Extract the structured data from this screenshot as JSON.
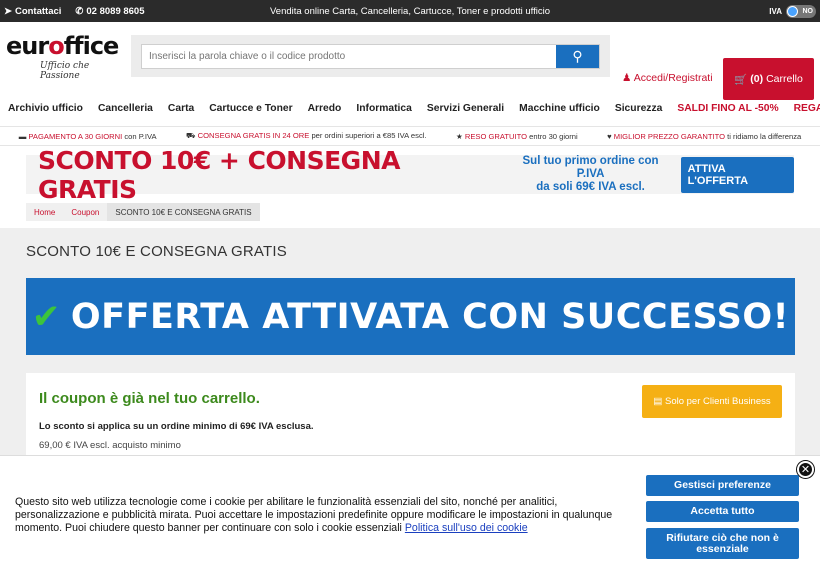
{
  "topbar": {
    "contacts": "Contattaci",
    "phone": "02 8089 8605",
    "center": "Vendita online Carta, Cancelleria, Cartucce, Toner e prodotti ufficio",
    "iva_label": "IVA",
    "iva_toggle": "NO"
  },
  "logo": {
    "word_left": "eur",
    "word_o": "o",
    "word_right": "ffice",
    "tagline": "Ufficio che Passione"
  },
  "search": {
    "placeholder": "Inserisci la parola chiave o il codice prodotto"
  },
  "account": {
    "login": "Accedi/Registrati"
  },
  "cart": {
    "count": "(0)",
    "label": "Carrello"
  },
  "nav": [
    "Archivio ufficio",
    "Cancelleria",
    "Carta",
    "Cartucce e Toner",
    "Arredo",
    "Informatica",
    "Servizi Generali",
    "Macchine ufficio",
    "Sicurezza"
  ],
  "nav_sale": [
    "SALDI FINO AL -50%",
    "REGALI PER TE"
  ],
  "benefits": [
    {
      "hl": "PAGAMENTO A 30 GIORNI",
      "rest": " con P.IVA"
    },
    {
      "hl": "CONSEGNA GRATIS IN 24 ORE",
      "rest": " per ordini superiori a €85 IVA escl."
    },
    {
      "hl": "RESO GRATUITO",
      "rest": " entro 30 giorni"
    },
    {
      "hl": "MIGLIOR PREZZO GARANTITO",
      "rest": " ti ridiamo la differenza"
    }
  ],
  "promo": {
    "big": "SCONTO 10€ + CONSEGNA GRATIS",
    "small1": "Sul tuo primo ordine con P.IVA",
    "small2": "da soli 69€ IVA escl.",
    "button": "ATTIVA L'OFFERTA"
  },
  "breadcrumb": [
    "Home",
    "Coupon",
    "SCONTO 10€ E CONSEGNA GRATIS"
  ],
  "page": {
    "title": "SCONTO 10€ E CONSEGNA GRATIS",
    "success": "OFFERTA ATTIVATA CON SUCCESSO!",
    "coupon_title": "Il coupon è già nel tuo carrello.",
    "coupon_p1": "Lo sconto si applica su un ordine minimo di 69€ IVA esclusa.",
    "coupon_p2": "69,00 € IVA escl. acquisto minimo",
    "business": "Solo per Clienti Business"
  },
  "cookie": {
    "text": "Questo sito web utilizza tecnologie come i cookie per abilitare le funzionalità essenziali del sito, nonché per analitici, personalizzazione e pubblicità mirata. Puoi accettare le impostazioni predefinite oppure modificare le impostazioni in qualunque momento. Puoi chiudere questo banner per continuare con solo i cookie essenziali",
    "link": "Politica sull'uso dei cookie",
    "btn_prefs": "Gestisci preferenze",
    "btn_accept": "Accetta tutto",
    "btn_reject": "Rifiutare ciò che non è essenziale"
  }
}
